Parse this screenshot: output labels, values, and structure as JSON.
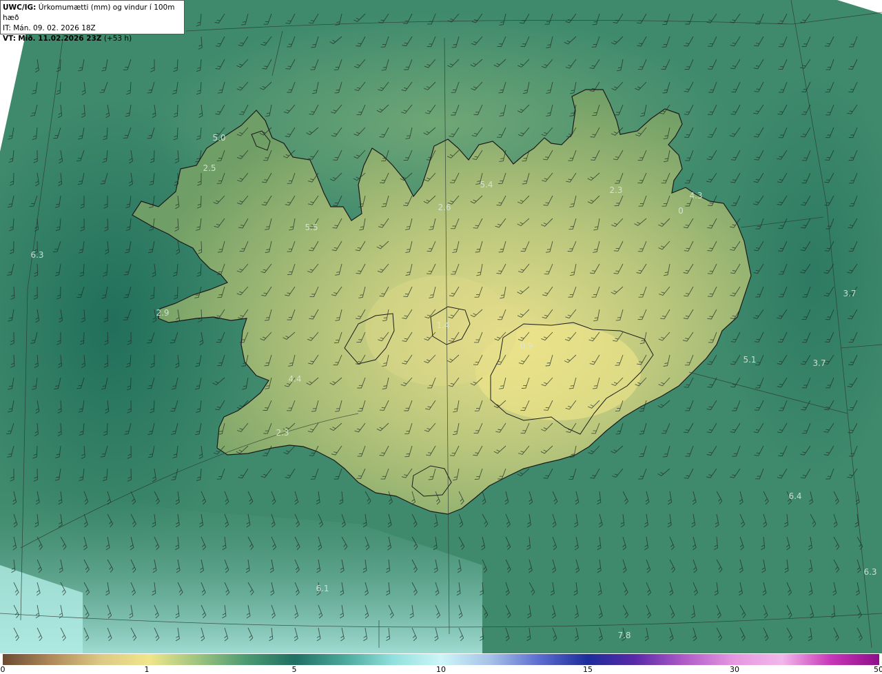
{
  "header": {
    "model": "UWC/IG:",
    "title": "Úrkomumætti (mm) og vindur í 100m hæð",
    "init_time": "IT: Mán. 09. 02. 2026 18Z",
    "valid_label": "VT:",
    "valid_time": "Mið. 11.02.2026 23Z",
    "lead_time": "(+53 h)"
  },
  "map_labels": [
    "5.0",
    "2.5",
    "5.4",
    "2.3",
    "2.6",
    "4.3",
    "0",
    "5.5",
    "6.3",
    "3.7",
    "2.9",
    "1.4",
    "0.9",
    "5.1",
    "3.7",
    "4.4",
    "2.3",
    "6.4",
    "6.3",
    "6.1",
    "7.8"
  ],
  "colorbar": {
    "ticks": [
      "0",
      "1",
      "5",
      "10",
      "15",
      "30",
      "50"
    ],
    "colors": [
      "#6b4a32",
      "#b08a5a",
      "#dcc884",
      "#f0e68a",
      "#9ec480",
      "#4c9a72",
      "#1f6f63",
      "#4aa79a",
      "#8fe0dc",
      "#cdf6f8",
      "#a7c2e8",
      "#5c6fd0",
      "#1c2c9a",
      "#5a2aa8",
      "#b05cc8",
      "#e696e0",
      "#f2b8ea",
      "#c838b8",
      "#8e0e8a"
    ]
  },
  "map": {
    "colors": {
      "ocean": "#3f8a6d",
      "ocean_dark": "#236f5b",
      "ocean_light": "#8fd4c8",
      "land_low": "#6e9e66",
      "land_high": "#e6e08c",
      "coast": "#1a1a1a",
      "barb": "#1f2b22"
    }
  }
}
